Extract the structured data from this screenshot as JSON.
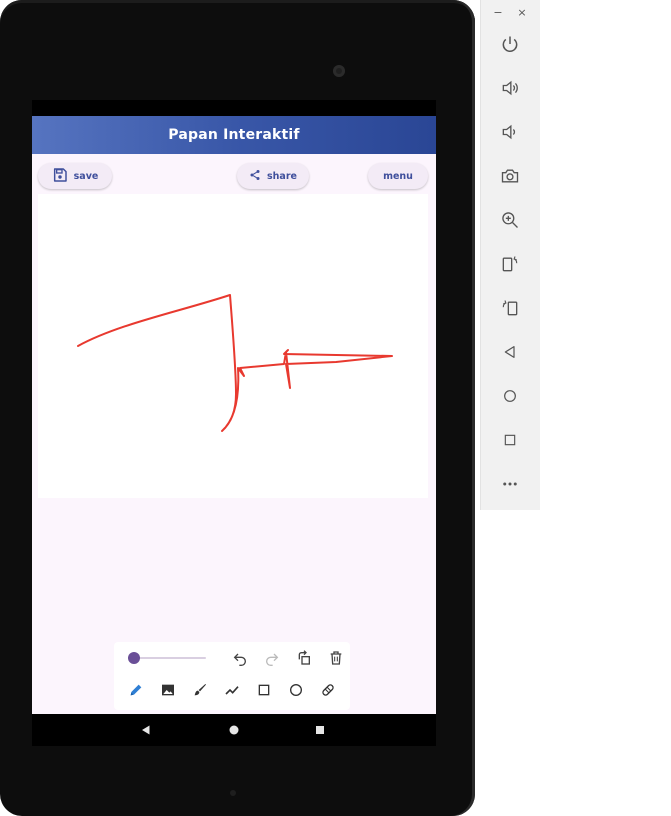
{
  "app": {
    "title": "Papan Interaktif",
    "buttons": {
      "save": "save",
      "share": "share",
      "menu": "menu"
    },
    "colors": {
      "appbar_start": "#5674c0",
      "appbar_end": "#2a4695",
      "stroke": "#e8392f",
      "accent": "#3f4f9c",
      "slider": "#6a4f97",
      "selected_tool": "#2f7fd4"
    },
    "stroke_size_level": 0.0,
    "selected_tool": "pencil"
  },
  "toolbar": {
    "row1_icons": [
      "undo-icon",
      "redo-icon",
      "rotate-icon",
      "trash-icon"
    ],
    "row2_icons": [
      "pencil-icon",
      "image-icon",
      "brush-icon",
      "line-icon",
      "rectangle-icon",
      "circle-icon",
      "eraser-icon"
    ]
  },
  "navbar": {
    "icons": [
      "back-icon",
      "home-icon",
      "recents-icon"
    ]
  },
  "emulator": {
    "window_icons": [
      "minimize-icon",
      "close-icon"
    ],
    "window_glyphs": {
      "minimize": "−",
      "close": "×"
    },
    "icons": [
      "power-icon",
      "volume-up-icon",
      "volume-down-icon",
      "camera-icon",
      "zoom-icon",
      "rotate-left-icon",
      "rotate-right-icon",
      "back-icon",
      "home-icon",
      "overview-icon",
      "more-icon"
    ]
  }
}
